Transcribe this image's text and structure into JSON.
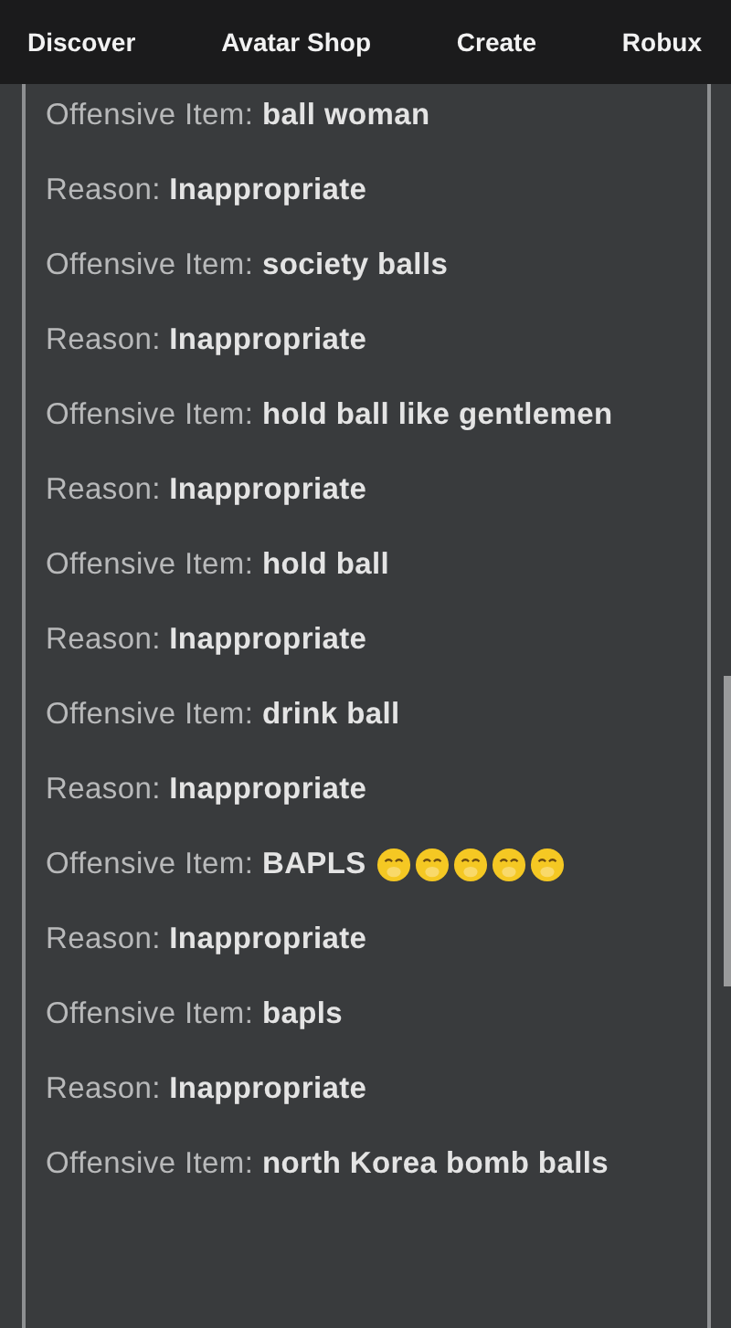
{
  "nav": {
    "items": [
      "Discover",
      "Avatar Shop",
      "Create",
      "Robux"
    ]
  },
  "entries": [
    {
      "kind": "text",
      "text": "Offensive Item: **ball woman**"
    },
    {
      "kind": "text",
      "text": "Reason: **Inappropriate**"
    },
    {
      "kind": "text",
      "text": "Offensive Item: **society balls**"
    },
    {
      "kind": "text",
      "text": "Reason: **Inappropriate**"
    },
    {
      "kind": "text",
      "text": "Offensive Item: **hold ball like gentlemen**"
    },
    {
      "kind": "text",
      "text": "Reason: **Inappropriate**"
    },
    {
      "kind": "text",
      "text": "Offensive Item: **hold ball**"
    },
    {
      "kind": "text",
      "text": "Reason: **Inappropriate**"
    },
    {
      "kind": "text",
      "text": "Offensive Item: **drink ball**"
    },
    {
      "kind": "text",
      "text": "Reason: **Inappropriate**"
    },
    {
      "kind": "emoji",
      "text": "Offensive Item: **BAPLS**"
    },
    {
      "kind": "text",
      "text": "Reason: **Inappropriate**"
    },
    {
      "kind": "text",
      "text": "Offensive Item: **bapls**"
    },
    {
      "kind": "text",
      "text": "Reason: **Inappropriate**"
    },
    {
      "kind": "text",
      "text": "Offensive Item: **north Korea bomb balls**"
    }
  ]
}
